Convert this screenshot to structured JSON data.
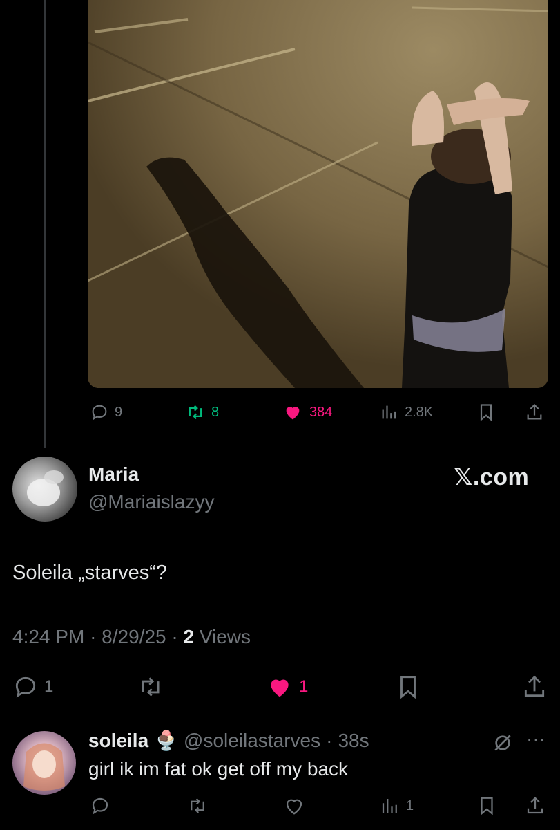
{
  "top_tweet": {
    "image_alt": "",
    "actions": {
      "replies": "9",
      "retweets": "8",
      "likes": "384",
      "views": "2.8K"
    }
  },
  "main_tweet": {
    "name": "Maria",
    "handle": "@Mariaislazyy",
    "watermark": "𝕏.com",
    "text": "Soleila „starves“?",
    "time": "4:24 PM",
    "date": "8/29/25",
    "views_count": "2",
    "views_label": "Views",
    "sep": "·",
    "actions": {
      "replies": "1",
      "likes": "1"
    }
  },
  "reply": {
    "name": "soleila",
    "emoji": "🍨",
    "handle": "@soleilastarves",
    "sep": "·",
    "time": "38s",
    "text": "girl ik im fat ok get off my back",
    "more": "···",
    "actions": {
      "views": "1"
    }
  },
  "colors": {
    "background": "#000000",
    "text": "#e7e9ea",
    "muted": "#71767b",
    "retweet_green": "#00ba7c",
    "like_pink": "#f91880",
    "divider": "#2f3336"
  }
}
